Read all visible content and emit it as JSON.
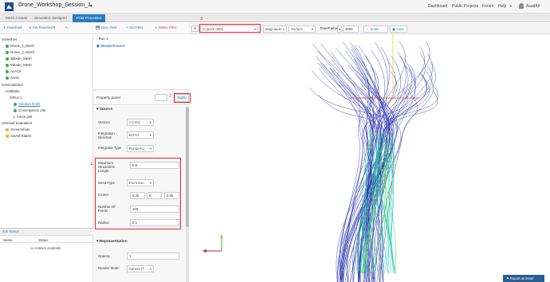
{
  "header": {
    "project_title": "Drone_Workshop_Session_1",
    "nav": [
      "Dashboard",
      "Public Projects",
      "Forum",
      "Help",
      "AsadAli"
    ]
  },
  "tabs": [
    "Mesh Creator",
    "Simulation Designer",
    "Post-Processor"
  ],
  "left_toolbar": {
    "download": "Download",
    "get_paraview": "Get ParaViewR"
  },
  "tree": {
    "meshes_label": "Meshes",
    "meshes": [
      "Drone_1_Mesh",
      "Drone_2_Mesh",
      "3Blade_Mesh",
      "5Blade_Mesh",
      "AoA10",
      "AoA5"
    ],
    "simulations_label": "Simulations",
    "sim": "3Blade",
    "run": "Run 1",
    "run_children": [
      "Solution fields",
      "Convergence plot",
      "Force plot"
    ],
    "result_eval": "Result Evaluation",
    "screenshots": "Screenshots",
    "saved_states": "Saved States"
  },
  "job_status": {
    "title": "Job Status",
    "col_name": "Name",
    "col_status": "Status",
    "empty": "no entities available"
  },
  "mid_toolbar": {
    "save_state": "Save State",
    "add_filter": "Add Filter",
    "delete_filter": "Delete Filter"
  },
  "pipeline": {
    "run": "Run 1",
    "filter": "StreamTracer1"
  },
  "property_panel": {
    "label": "Property panel",
    "apply": "Apply"
  },
  "source": {
    "title": "Source",
    "vectors_label": "Vectors",
    "vectors_value": "U [m/s]",
    "integration_direction_label": "Integration Direction",
    "integration_direction_value": "BOTH",
    "integrator_type_label": "Integrator Type",
    "integrator_type_value": "Runge-Ku",
    "max_len_label": "Maximum Streamline Length",
    "max_len_value": "0.8",
    "seed_type_label": "Seed Type",
    "seed_type_value": "Point Sou",
    "center_label": "Center",
    "center_values": [
      "0.05",
      "0",
      "0.05"
    ],
    "num_points_label": "Number Of Points",
    "num_points_value": "100",
    "radius_label": "Radius",
    "radius_value": "0.1"
  },
  "representation": {
    "title": "Representation",
    "opacity_label": "Opacity",
    "opacity_value": "1",
    "render_mode_label": "Render Mode",
    "render_mode_value": "Sphere (T"
  },
  "view_toolbar": {
    "field_label": "Field:",
    "field_value": "U (point data)",
    "magnitude": "Magnitude",
    "surface": "Surface",
    "timeframe_label": "TimeFrame",
    "timeframe_value": "3000",
    "scale": "Scale",
    "view": "View"
  },
  "annotations": [
    "1",
    "2",
    "3"
  ],
  "report": "Report an issue",
  "colors": {
    "accent": "#2b79c2",
    "annotation": "#ee2233",
    "stream_blue": "#1f2aa8",
    "stream_cyan": "#1fc8c0",
    "stream_green": "#3fd86a"
  }
}
